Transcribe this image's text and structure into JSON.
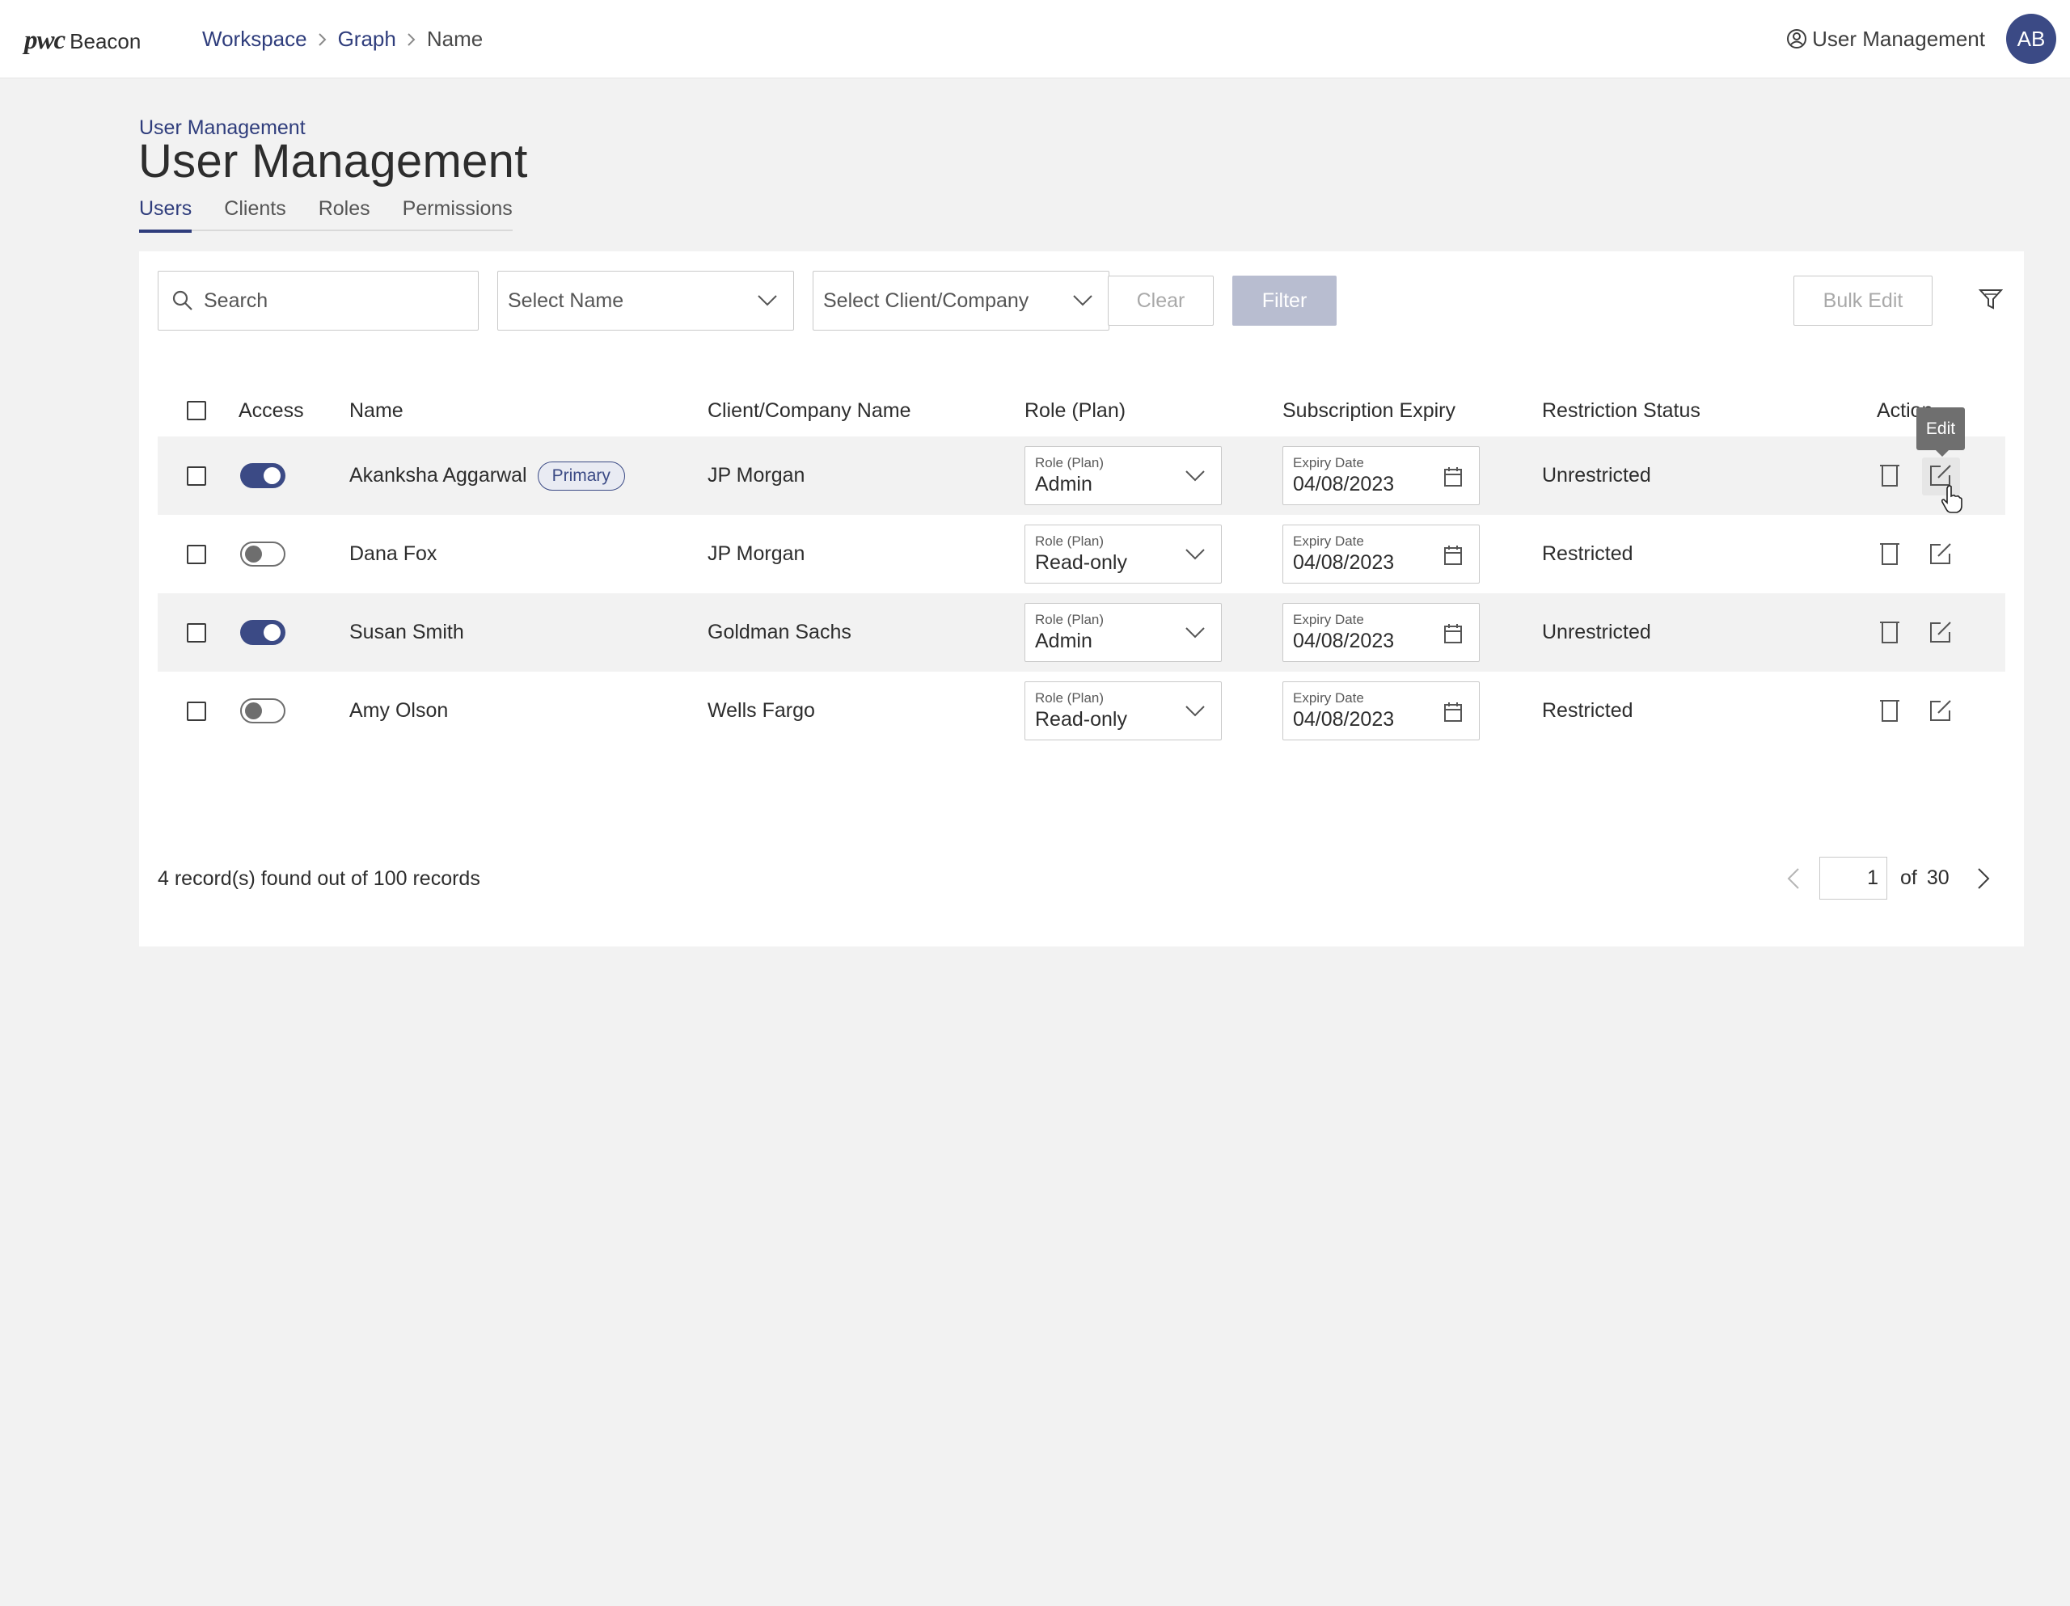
{
  "app": {
    "brand_mark": "pwc",
    "brand_name": "Beacon"
  },
  "breadcrumb": {
    "items": [
      "Workspace",
      "Graph"
    ],
    "current": "Name"
  },
  "user_menu": {
    "label": "User Management",
    "avatar_initials": "AB"
  },
  "page": {
    "crumb": "User Management",
    "title": "User Management"
  },
  "tabs": [
    {
      "label": "Users",
      "active": true
    },
    {
      "label": "Clients",
      "active": false
    },
    {
      "label": "Roles",
      "active": false
    },
    {
      "label": "Permissions",
      "active": false
    }
  ],
  "toolbar": {
    "search_placeholder": "Search",
    "name_select": "Select Name",
    "client_select": "Select Client/Company",
    "clear_label": "Clear",
    "filter_label": "Filter",
    "bulk_edit_label": "Bulk Edit"
  },
  "table": {
    "columns": [
      "Access",
      "Name",
      "Client/Company Name",
      "Role (Plan)",
      "Subscription Expiry",
      "Restriction Status",
      "Action"
    ],
    "role_field_label": "Role (Plan)",
    "expiry_field_label": "Expiry Date",
    "rows": [
      {
        "access": true,
        "name": "Akanksha Aggarwal",
        "badge": "Primary",
        "company": "JP Morgan",
        "role": "Admin",
        "expiry": "04/08/2023",
        "status": "Unrestricted"
      },
      {
        "access": false,
        "name": "Dana Fox",
        "badge": "",
        "company": "JP Morgan",
        "role": "Read-only",
        "expiry": "04/08/2023",
        "status": "Restricted"
      },
      {
        "access": true,
        "name": "Susan Smith",
        "badge": "",
        "company": "Goldman Sachs",
        "role": "Admin",
        "expiry": "04/08/2023",
        "status": "Unrestricted"
      },
      {
        "access": false,
        "name": "Amy Olson",
        "badge": "",
        "company": "Wells Fargo",
        "role": "Read-only",
        "expiry": "04/08/2023",
        "status": "Restricted"
      }
    ]
  },
  "tooltip": {
    "label": "Edit"
  },
  "footer": {
    "records_text": "4 record(s) found out of 100 records",
    "page": "1",
    "of_label": "of",
    "total_pages": "30"
  },
  "colors": {
    "accent": "#3b4a85",
    "link": "#2f3d7c",
    "background": "#f2f2f2"
  }
}
